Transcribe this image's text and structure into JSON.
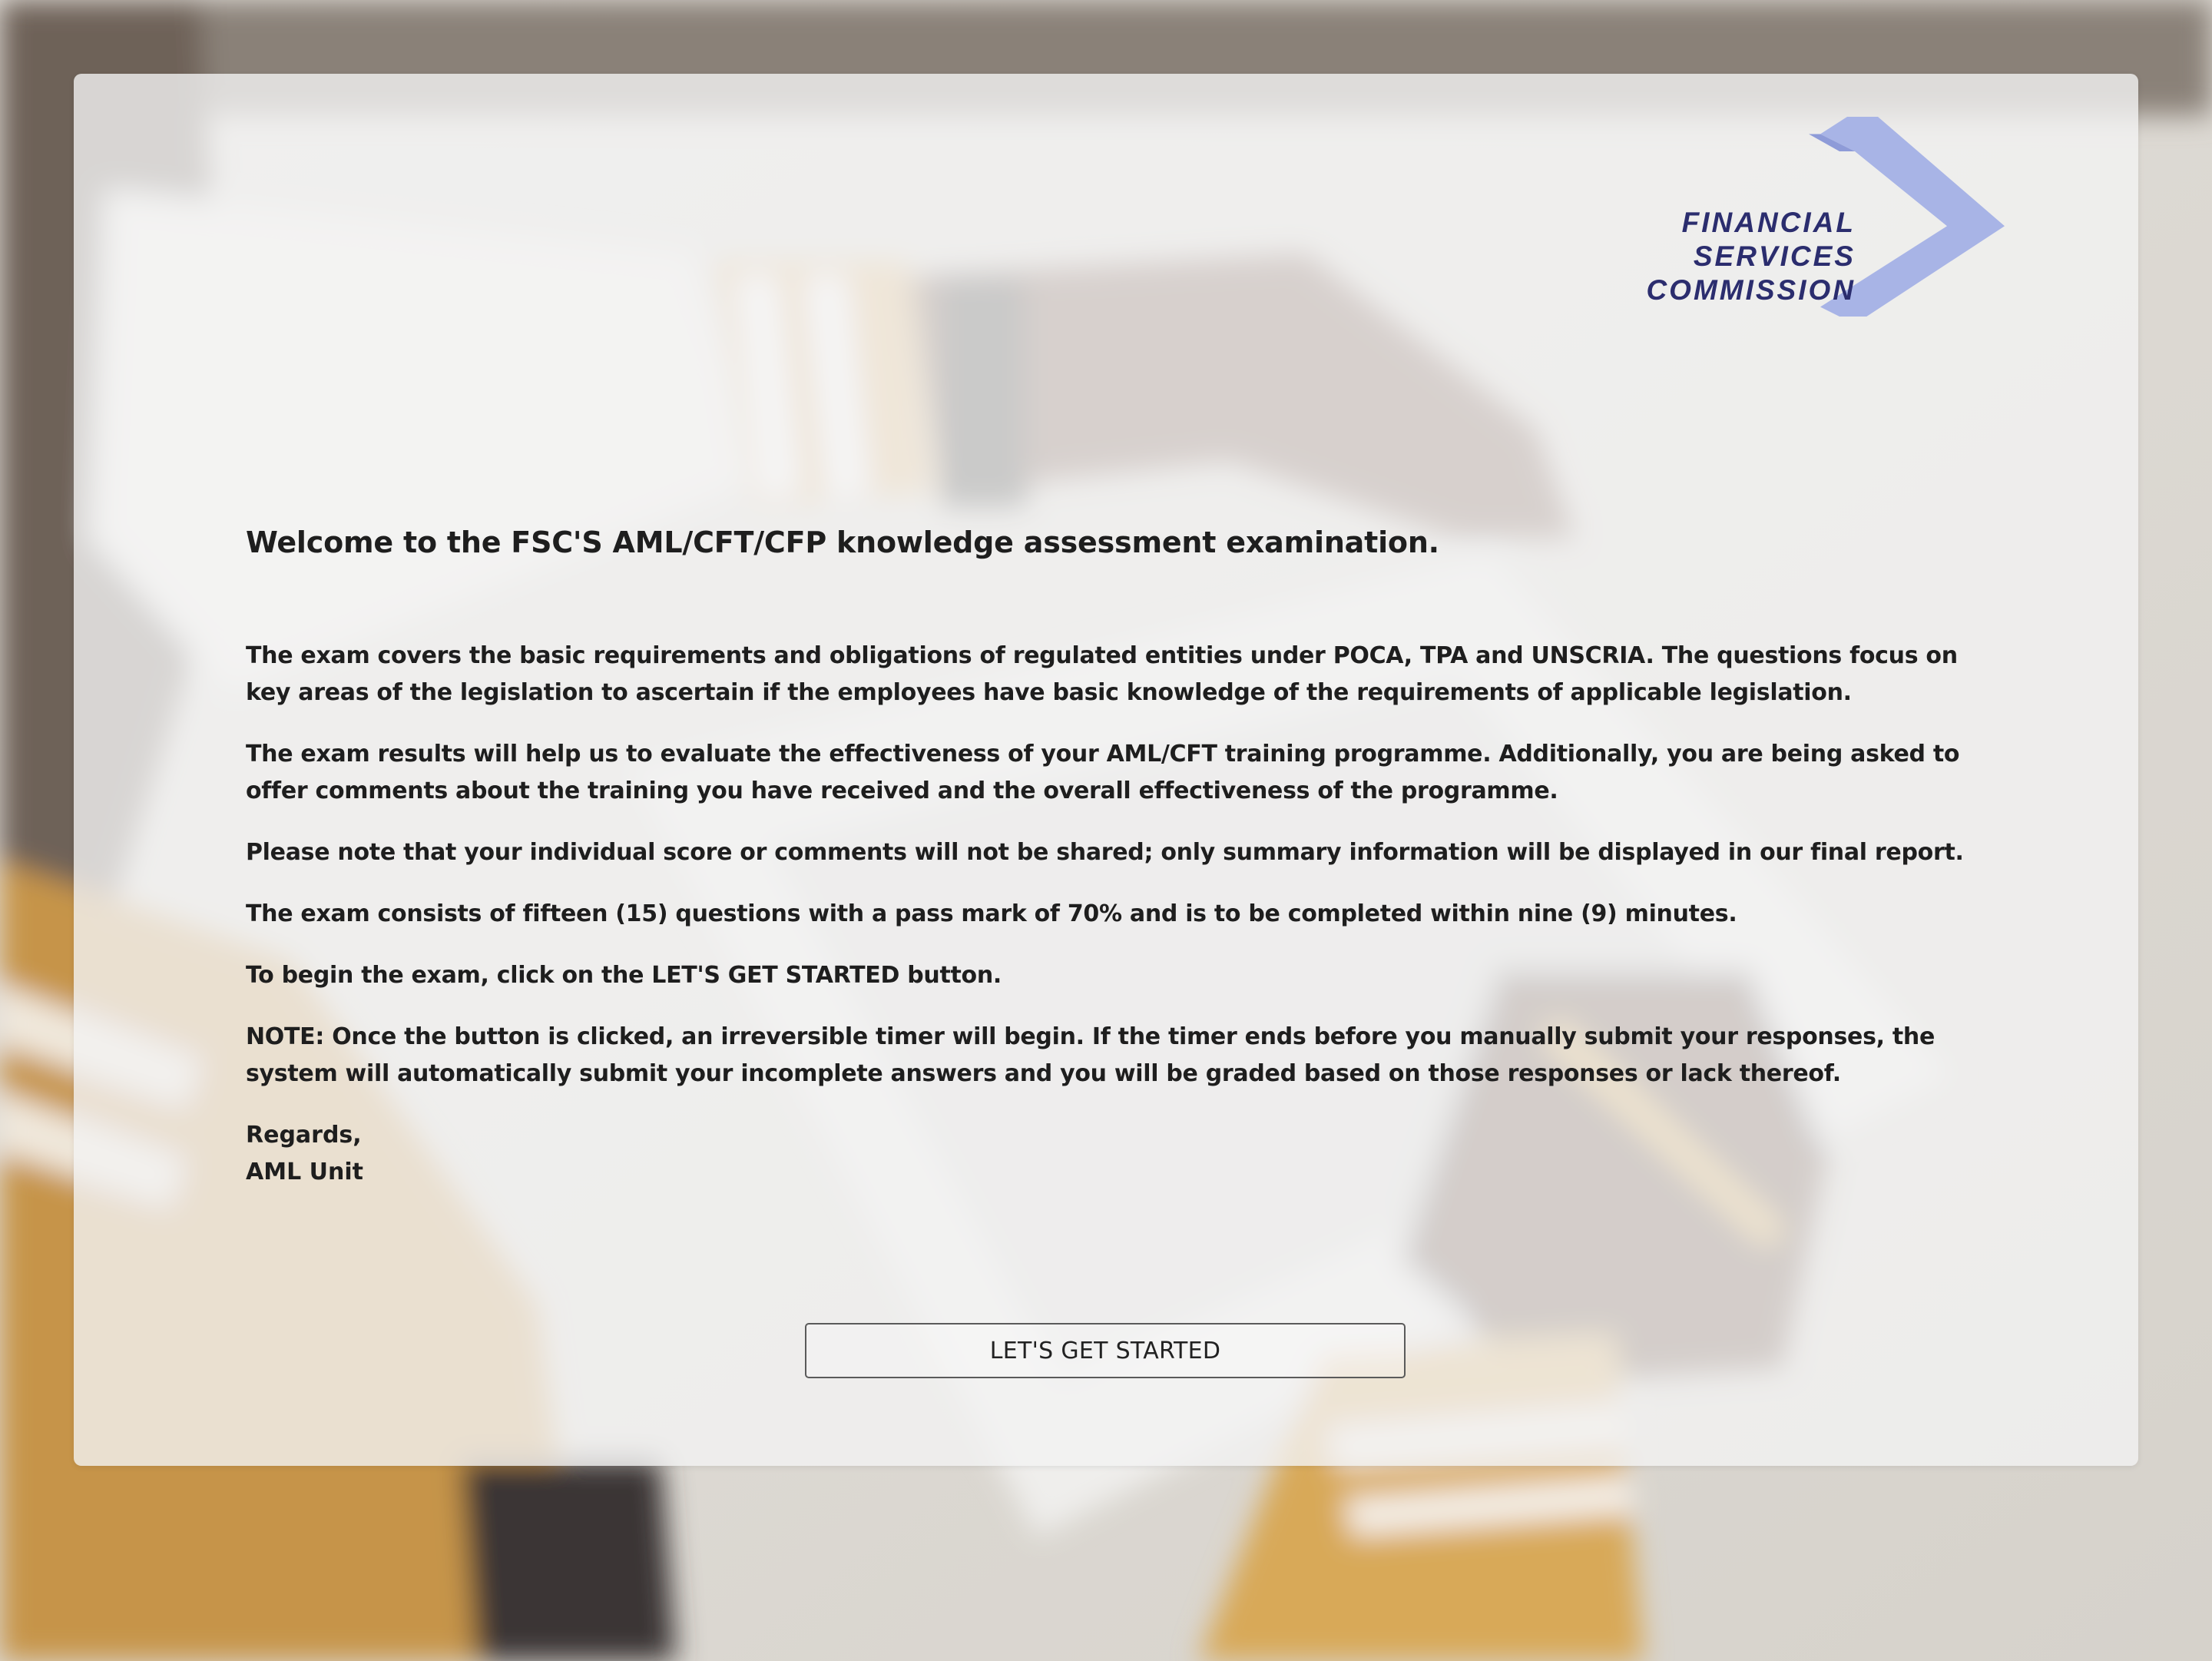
{
  "logo": {
    "line1": "FINANCIAL",
    "line2": "SERVICES",
    "line3": "COMMISSION"
  },
  "main": {
    "heading": "Welcome to the FSC'S AML/CFT/CFP knowledge assessment examination.",
    "paragraphs": [
      "The exam covers the basic requirements and obligations of regulated entities under POCA, TPA and UNSCRIA. The questions focus on key areas of the legislation to ascertain if the employees have basic knowledge of the requirements of applicable legislation.",
      "The exam results will help us to evaluate the effectiveness of your AML/CFT training programme. Additionally, you are being asked to offer comments about the training you have received and the overall effectiveness of the programme.",
      "Please note that your individual score or comments will not be shared; only summary information will be displayed in our final report.",
      "The exam consists of fifteen (15) questions with a pass mark of 70% and is to be completed within nine (9) minutes.",
      "To begin the exam, click on the LET'S GET STARTED button.",
      "NOTE: Once the button is clicked, an irreversible timer will begin. If the timer ends before you manually submit your responses, the system will automatically submit your incomplete answers and you will be graded based on those responses or lack thereof."
    ],
    "regards": "Regards,",
    "signature": "AML Unit",
    "start_button": "LET'S GET STARTED"
  },
  "colors": {
    "logo_text": "#2b2d6e",
    "logo_shape": "#9aa8e0",
    "panel_bg": "#f2f2f2",
    "text": "#1e1e1e"
  }
}
